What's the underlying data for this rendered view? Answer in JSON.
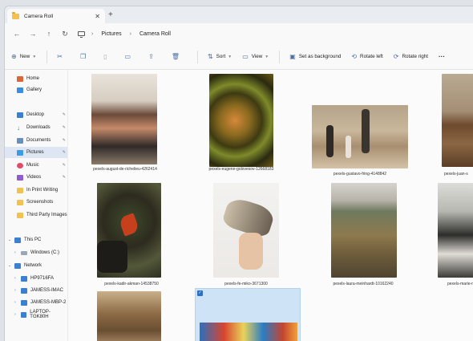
{
  "tab": {
    "title": "Camera Roll",
    "close": "✕",
    "new": "+"
  },
  "nav": {
    "back": "←",
    "forward": "→",
    "up": "↑",
    "refresh": "↻"
  },
  "address": {
    "sep1": "›",
    "crumb1": "Pictures",
    "sep2": "›",
    "crumb2": "Camera Roll"
  },
  "toolbar": {
    "new_label": "New",
    "cut_icon": "scissors-icon",
    "sort_label": "Sort",
    "view_label": "View",
    "set_bg_label": "Set as background",
    "rotate_left_label": "Rotate left",
    "rotate_right_label": "Rotate right",
    "more_label": "···"
  },
  "sidebar": {
    "home": "Home",
    "gallery": "Gallery",
    "desktop": "Desktop",
    "downloads": "Downloads",
    "documents": "Documents",
    "pictures": "Pictures",
    "music": "Music",
    "videos": "Videos",
    "folder1": "In Print Writing",
    "folder2": "Screenshots",
    "folder3": "Third Party Images",
    "this_pc": "This PC",
    "windows_c": "Windows (C:)",
    "network": "Network",
    "net1": "HP9716FA",
    "net2": "JAMESS-IMAC",
    "net3": "JAMESS-MBP-2",
    "net4": "LAPTOP-TGK80H"
  },
  "files": {
    "f1": "pexels-august-de-richelieu-4262414",
    "f2": "pexels-eugene-golovesov-12668183",
    "f3": "pexels-gustavo-fring-4148842",
    "f4": "pexels-juan-s",
    "f5": "pexels-kadir-akman-14538750",
    "f6": "pexels-fe-miko-3671300",
    "f7": "pexels-laura-meinhardt-10162240",
    "f8": "pexels-marie-m",
    "check": "✓"
  },
  "colors": {
    "accent": "#2c6fc8",
    "selection": "#cfe3f6",
    "folder": "#f2c14e"
  }
}
